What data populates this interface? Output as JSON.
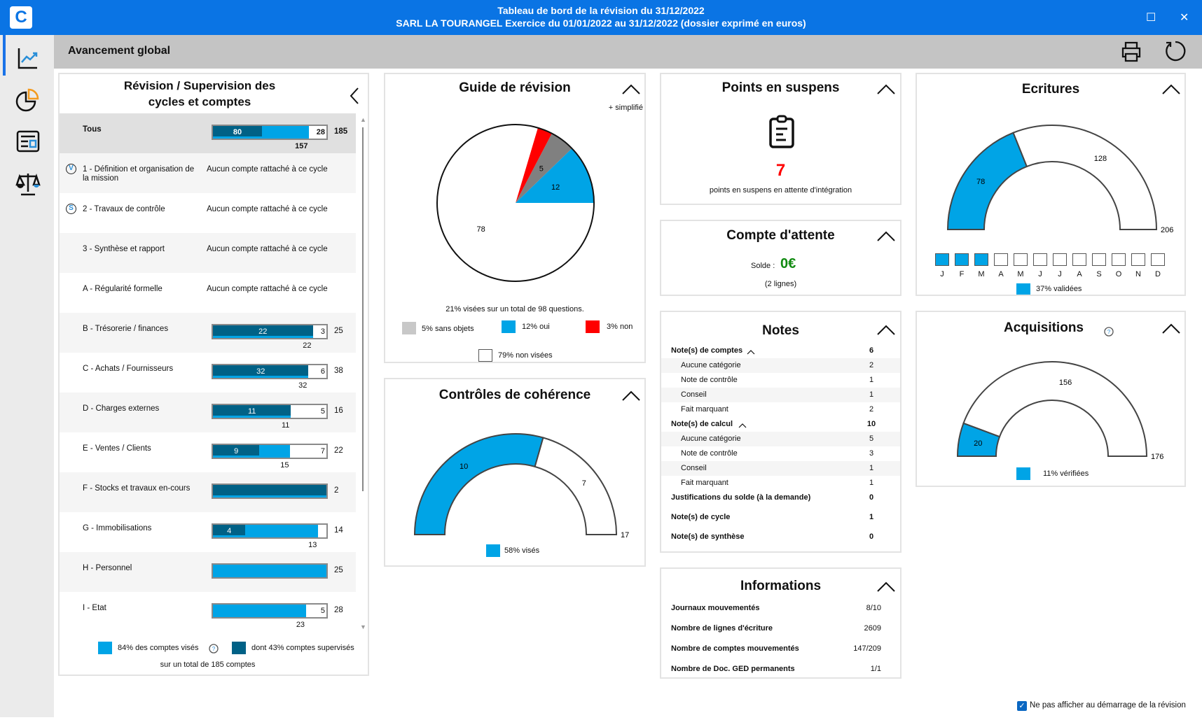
{
  "window": {
    "title_line1": "Tableau de bord de la révision du 31/12/2022",
    "title_line2": "SARL LA TOURANGEL Exercice du 01/01/2022 au 31/12/2022 (dossier exprimé en euros)",
    "logo": "C"
  },
  "sidebar": {
    "items": [
      {
        "icon": "trend-chart-icon",
        "active": true
      },
      {
        "icon": "pie-chart-icon"
      },
      {
        "icon": "dashboard-card-icon"
      },
      {
        "icon": "balance-scale-icon"
      }
    ]
  },
  "header": {
    "title": "Avancement global"
  },
  "colors": {
    "brand": "#0a74e4",
    "viewed": "#00a4e6",
    "supervised": "#006186",
    "not_ok": "#ff0000",
    "na": "#c8c8c8",
    "green": "#108a10"
  },
  "cycles": {
    "title_line1": "Révision / Supervision des",
    "title_line2": "cycles et comptes",
    "rows": [
      {
        "label": "Tous",
        "bold": true,
        "supervised": 80,
        "viewed": 157,
        "not_viewed": 28,
        "total": 185
      },
      {
        "label": "1 - Définition et organisation de la mission",
        "icon": "V",
        "note": "Aucun compte rattaché à ce cycle"
      },
      {
        "label": "2 - Travaux de contrôle",
        "icon": "S",
        "note": "Aucun compte rattaché à ce cycle"
      },
      {
        "label": "3 - Synthèse et rapport",
        "note": "Aucun compte rattaché à ce cycle"
      },
      {
        "label": "A - Régularité formelle",
        "note": "Aucun compte rattaché à ce cycle"
      },
      {
        "label": "B - Trésorerie / finances",
        "supervised": 22,
        "viewed": 22,
        "not_viewed": 3,
        "total": 25
      },
      {
        "label": "C - Achats / Fournisseurs",
        "supervised": 32,
        "viewed": 32,
        "not_viewed": 6,
        "total": 38
      },
      {
        "label": "D - Charges externes",
        "supervised": 11,
        "viewed": 11,
        "not_viewed": 5,
        "total": 16
      },
      {
        "label": "E - Ventes / Clients",
        "supervised": 9,
        "viewed": 15,
        "not_viewed": 7,
        "total": 22
      },
      {
        "label": "F - Stocks et travaux en-cours",
        "supervised": 2,
        "viewed": 2,
        "not_viewed": 0,
        "total": 2
      },
      {
        "label": "G - Immobilisations",
        "supervised": 4,
        "viewed": 13,
        "not_viewed": 1,
        "total": 14
      },
      {
        "label": "H - Personnel",
        "supervised": 0,
        "viewed": 25,
        "not_viewed": 0,
        "total": 25
      },
      {
        "label": "I - Etat",
        "supervised": 0,
        "viewed": 23,
        "not_viewed": 5,
        "total": 28
      }
    ],
    "legend_viewed": "84% des comptes visés",
    "legend_supervised": "dont 43% comptes supervisés",
    "footer": "sur un total de 185 comptes"
  },
  "guide": {
    "title": "Guide de révision",
    "mode": "+ simplifié",
    "summary": "21% visées sur un total de 98 questions.",
    "legend": [
      {
        "label": "5% sans objets",
        "color": "#c8c8c8"
      },
      {
        "label": "12% oui",
        "color": "#00a4e6"
      },
      {
        "label": "3% non",
        "color": "#ff0000"
      },
      {
        "label": "79% non visées",
        "color": "#ffffff"
      }
    ]
  },
  "coherence": {
    "title": "Contrôles de cohérence",
    "legend": "58% visés"
  },
  "suspens": {
    "title": "Points en suspens",
    "count": "7",
    "text": "points en suspens en attente d'intégration"
  },
  "attente": {
    "title": "Compte d'attente",
    "solde_label": "Solde :",
    "solde": "0€",
    "lines": "(2 lignes)"
  },
  "notes": {
    "title": "Notes",
    "rows": [
      {
        "label": "Note(s) de comptes",
        "value": "6",
        "level": 0,
        "expander": true
      },
      {
        "label": "Aucune catégorie",
        "value": "2",
        "level": 1
      },
      {
        "label": "Note de contrôle",
        "value": "1",
        "level": 1
      },
      {
        "label": "Conseil",
        "value": "1",
        "level": 1
      },
      {
        "label": "Fait marquant",
        "value": "2",
        "level": 1
      },
      {
        "label": "Note(s) de calcul",
        "value": "10",
        "level": 0,
        "expander": true
      },
      {
        "label": "Aucune catégorie",
        "value": "5",
        "level": 1
      },
      {
        "label": "Note de contrôle",
        "value": "3",
        "level": 1
      },
      {
        "label": "Conseil",
        "value": "1",
        "level": 1
      },
      {
        "label": "Fait marquant",
        "value": "1",
        "level": 1
      },
      {
        "label": "Justifications du solde (à la demande)",
        "value": "0",
        "level": 0
      },
      {
        "label": "Note(s) de cycle",
        "value": "1",
        "level": 0
      },
      {
        "label": "Note(s) de synthèse",
        "value": "0",
        "level": 0
      }
    ]
  },
  "informations": {
    "title": "Informations",
    "rows": [
      {
        "label": "Journaux mouvementés",
        "value": "8/10"
      },
      {
        "label": "Nombre de lignes d'écriture",
        "value": "2609"
      },
      {
        "label": "Nombre de comptes mouvementés",
        "value": "147/209"
      },
      {
        "label": "Nombre de Doc. GED permanents",
        "value": "1/1"
      }
    ]
  },
  "ecritures": {
    "title": "Ecritures",
    "months": [
      {
        "m": "J",
        "validated": true
      },
      {
        "m": "F",
        "validated": true
      },
      {
        "m": "M",
        "validated": true
      },
      {
        "m": "A",
        "validated": false
      },
      {
        "m": "M",
        "validated": false
      },
      {
        "m": "J",
        "validated": false
      },
      {
        "m": "J",
        "validated": false
      },
      {
        "m": "A",
        "validated": false
      },
      {
        "m": "S",
        "validated": false
      },
      {
        "m": "O",
        "validated": false
      },
      {
        "m": "N",
        "validated": false
      },
      {
        "m": "D",
        "validated": false
      }
    ],
    "legend": "37% validées"
  },
  "acquisitions": {
    "title": "Acquisitions",
    "legend": "11% vérifiées"
  },
  "footer": {
    "dont_show_label": "Ne pas afficher au démarrage de la révision",
    "dont_show_checked": true
  },
  "chart_data": [
    {
      "type": "pie",
      "id": "guide",
      "slices": [
        {
          "label": "oui",
          "value": 12,
          "color": "#00a4e6",
          "shown": true
        },
        {
          "label": "sans objets",
          "value": 5,
          "color": "#808080",
          "shown": true
        },
        {
          "label": "non",
          "value": 3,
          "color": "#ff0000",
          "shown": false
        },
        {
          "label": "non visées",
          "value": 78,
          "color": "#ffffff",
          "shown": true
        }
      ]
    },
    {
      "type": "gauge",
      "id": "coherence",
      "done": 10,
      "remaining": 7,
      "total": 17
    },
    {
      "type": "gauge",
      "id": "ecritures",
      "done": 78,
      "remaining": 128,
      "total": 206
    },
    {
      "type": "gauge",
      "id": "acquisitions",
      "done": 20,
      "remaining": 156,
      "total": 176
    }
  ]
}
